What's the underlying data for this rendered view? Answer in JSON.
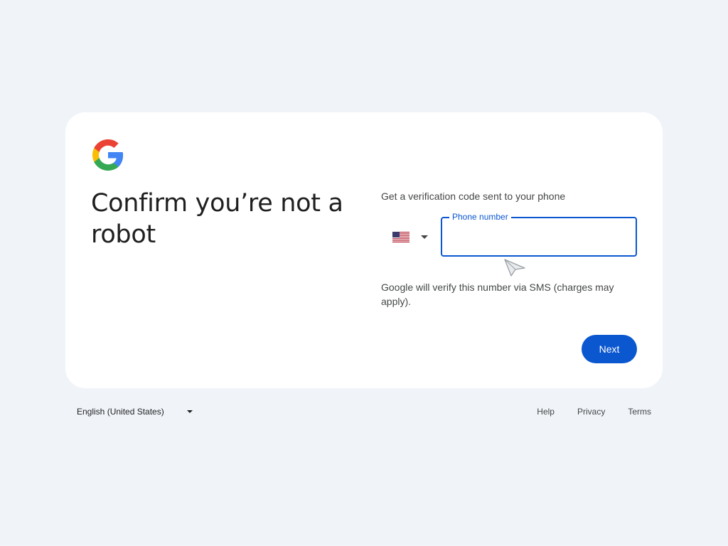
{
  "logo": {
    "icon": "google-g-logo-icon"
  },
  "title": "Confirm you’re not a robot",
  "subtitle": "Get a verification code sent to your phone",
  "country": {
    "icon": "us-flag-icon",
    "selected": "United States"
  },
  "phone": {
    "label": "Phone number",
    "value": ""
  },
  "help_text": "Google will verify this number via SMS (charges may apply).",
  "next_label": "Next",
  "footer": {
    "language": "English (United States)",
    "links": {
      "help": "Help",
      "privacy": "Privacy",
      "terms": "Terms"
    }
  },
  "colors": {
    "accent": "#0b57d0",
    "page_bg": "#f0f4f9",
    "card_bg": "#ffffff"
  }
}
